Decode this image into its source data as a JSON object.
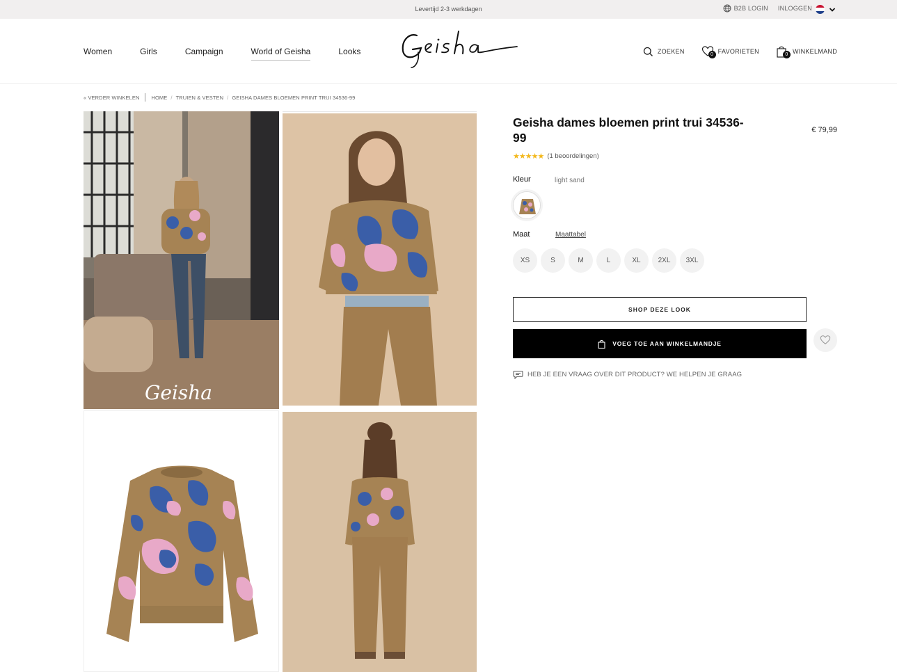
{
  "topbar": {
    "delivery": "Levertijd 2-3 werkdagen",
    "b2b_login": "B2B LOGIN",
    "login": "INLOGGEN"
  },
  "nav": {
    "items": [
      "Women",
      "Girls",
      "Campaign",
      "World of Geisha",
      "Looks"
    ],
    "active": "World of Geisha"
  },
  "logo": {
    "text": "Geisha"
  },
  "header_actions": {
    "search": "ZOEKEN",
    "favorites": "FAVORIETEN",
    "favorites_count": "0",
    "cart": "WINKELMAND",
    "cart_count": "0"
  },
  "breadcrumb": {
    "back": "« VERDER WINKELEN",
    "home": "HOME",
    "category": "TRUIEN & VESTEN",
    "current": "GEISHA DAMES BLOEMEN PRINT TRUI 34536-99"
  },
  "product": {
    "title": "Geisha dames bloemen print trui 34536-99",
    "price": "€ 79,99",
    "stars": "★★★★★",
    "reviews": "(1 beoordelingen)",
    "color_label": "Kleur",
    "color_value": "light sand",
    "size_label": "Maat",
    "size_chart": "Maattabel",
    "sizes": [
      "XS",
      "S",
      "M",
      "L",
      "XL",
      "2XL",
      "3XL"
    ],
    "shop_look": "SHOP DEZE LOOK",
    "add_to_cart": "VOEG TOE AAN WINKELMANDJE",
    "help": "HEB JE EEN VRAAG OVER DIT PRODUCT? WE HELPEN JE GRAAG"
  },
  "gallery": {
    "watermark": "Geisha"
  },
  "colors": {
    "sweater_base": "#a68354",
    "flower_blue": "#3a5ea8",
    "flower_pink": "#e8a9c8",
    "pants": "#a27d4f",
    "star": "#f3b81c"
  }
}
